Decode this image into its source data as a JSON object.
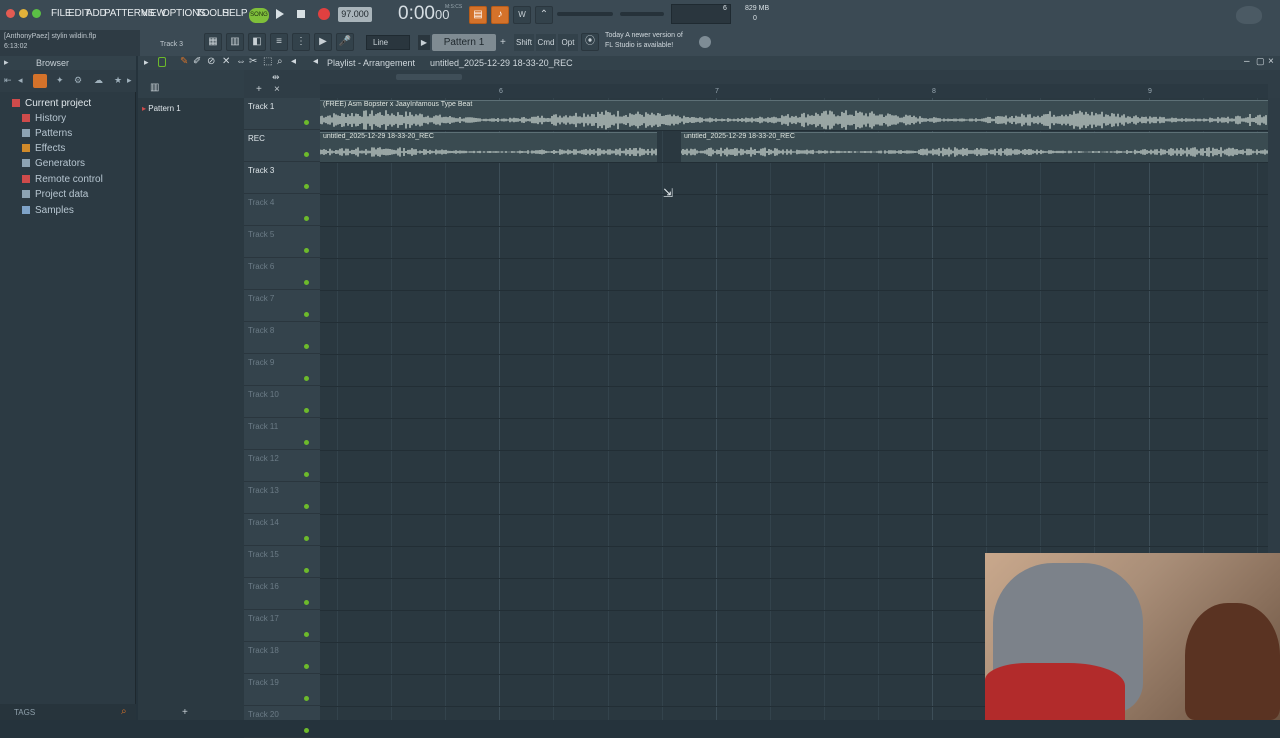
{
  "menu": [
    "FILE",
    "EDIT",
    "ADD",
    "PATTERNS",
    "VIEW",
    "OPTIONS",
    "TOOLS",
    "HELP"
  ],
  "transport": {
    "tempo": "97.000",
    "time": "0:00",
    "time_small": "00",
    "time_label": "M:S:CS",
    "mode_label": "SONG"
  },
  "memory": {
    "cpu": "6",
    "ram": "829 MB",
    "voices": "0"
  },
  "hint": {
    "file": "[AnthonyPaez] stylin wildin.flp",
    "time": "6:13:02",
    "track": "Track 3"
  },
  "toolbar2": {
    "snap": "Line",
    "pattern": "Pattern 1",
    "shift": "Shift",
    "cmd": "Cmd",
    "opt": "Opt",
    "news_line1": "Today  A newer version of",
    "news_line2": "FL Studio is available!"
  },
  "browser": {
    "title": "Browser",
    "items": [
      {
        "label": "Current project",
        "icon": "project-icon",
        "color": "#cf4b4b"
      },
      {
        "label": "History",
        "icon": "history-icon",
        "color": "#cf4b4b"
      },
      {
        "label": "Patterns",
        "icon": "patterns-icon",
        "color": "#8da3b3"
      },
      {
        "label": "Effects",
        "icon": "effects-icon",
        "color": "#d08a2a"
      },
      {
        "label": "Generators",
        "icon": "generators-icon",
        "color": "#8da3b3"
      },
      {
        "label": "Remote control",
        "icon": "remote-control-icon",
        "color": "#cf4b4b"
      },
      {
        "label": "Project data",
        "icon": "project-data-icon",
        "color": "#8da3b3"
      },
      {
        "label": "Samples",
        "icon": "samples-icon",
        "color": "#7fa3c8"
      }
    ],
    "tags": "TAGS"
  },
  "picker": {
    "pattern": "Pattern 1"
  },
  "playlist": {
    "title": "Playlist - Arrangement",
    "breadcrumb": "untitled_2025-12-29 18-33-20_REC",
    "ruler": [
      "6",
      "7",
      "8",
      "9"
    ],
    "tracks": [
      {
        "name": "Track 1",
        "active": true
      },
      {
        "name": "REC",
        "active": true
      },
      {
        "name": "Track 3",
        "active": true
      },
      {
        "name": "Track 4",
        "active": false
      },
      {
        "name": "Track 5",
        "active": false
      },
      {
        "name": "Track 6",
        "active": false
      },
      {
        "name": "Track 7",
        "active": false
      },
      {
        "name": "Track 8",
        "active": false
      },
      {
        "name": "Track 9",
        "active": false
      },
      {
        "name": "Track 10",
        "active": false
      },
      {
        "name": "Track 11",
        "active": false
      },
      {
        "name": "Track 12",
        "active": false
      },
      {
        "name": "Track 13",
        "active": false
      },
      {
        "name": "Track 14",
        "active": false
      },
      {
        "name": "Track 15",
        "active": false
      },
      {
        "name": "Track 16",
        "active": false
      },
      {
        "name": "Track 17",
        "active": false
      },
      {
        "name": "Track 18",
        "active": false
      },
      {
        "name": "Track 19",
        "active": false
      },
      {
        "name": "Track 20",
        "active": false
      }
    ],
    "clips": [
      {
        "title": "(FREE) Asm Bopster x JaayInfamous Type Beat",
        "track": 1
      },
      {
        "title": "untitled_2025-12-29 18-33-20_REC",
        "track": 2
      },
      {
        "title": "untitled_2025-12-29 18-33-20_REC",
        "track": 2
      }
    ]
  },
  "colors": {
    "accent": "#d4722a",
    "led": "#6dba2b",
    "clip": "#3a4b51",
    "record": "#e04040"
  }
}
